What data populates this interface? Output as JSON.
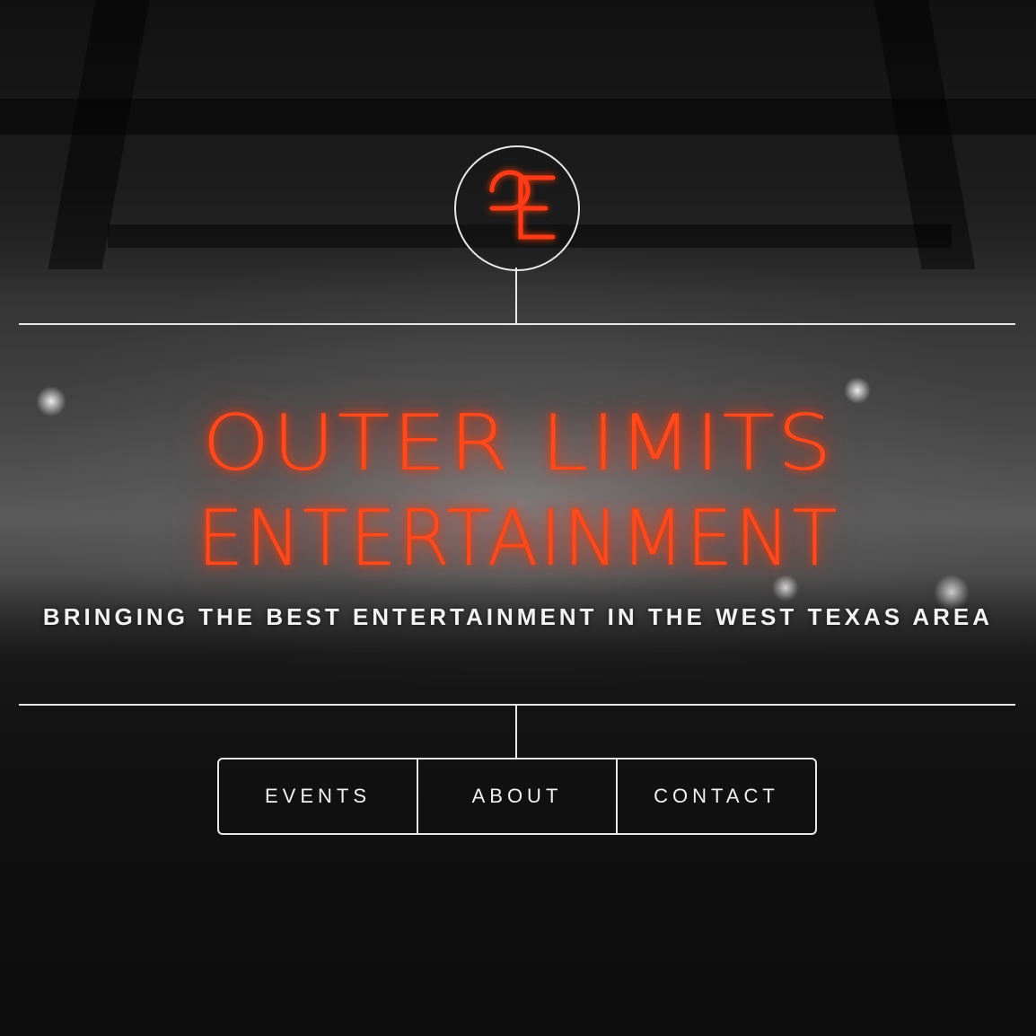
{
  "logo": {
    "monogram": "OE",
    "icon": "oe-monogram-icon",
    "color": "#ff3b1a"
  },
  "hero": {
    "title_line1": "OUTER LIMITS",
    "title_line2": "ENTERTAINMENT",
    "tagline": "BRINGING THE BEST ENTERTAINMENT IN THE WEST TEXAS AREA"
  },
  "nav": {
    "events": "EVENTS",
    "about": "ABOUT",
    "contact": "CONTACT"
  },
  "colors": {
    "neon": "#ff4a1e",
    "line": "#e8e8e8",
    "text": "#f2f2f2"
  }
}
